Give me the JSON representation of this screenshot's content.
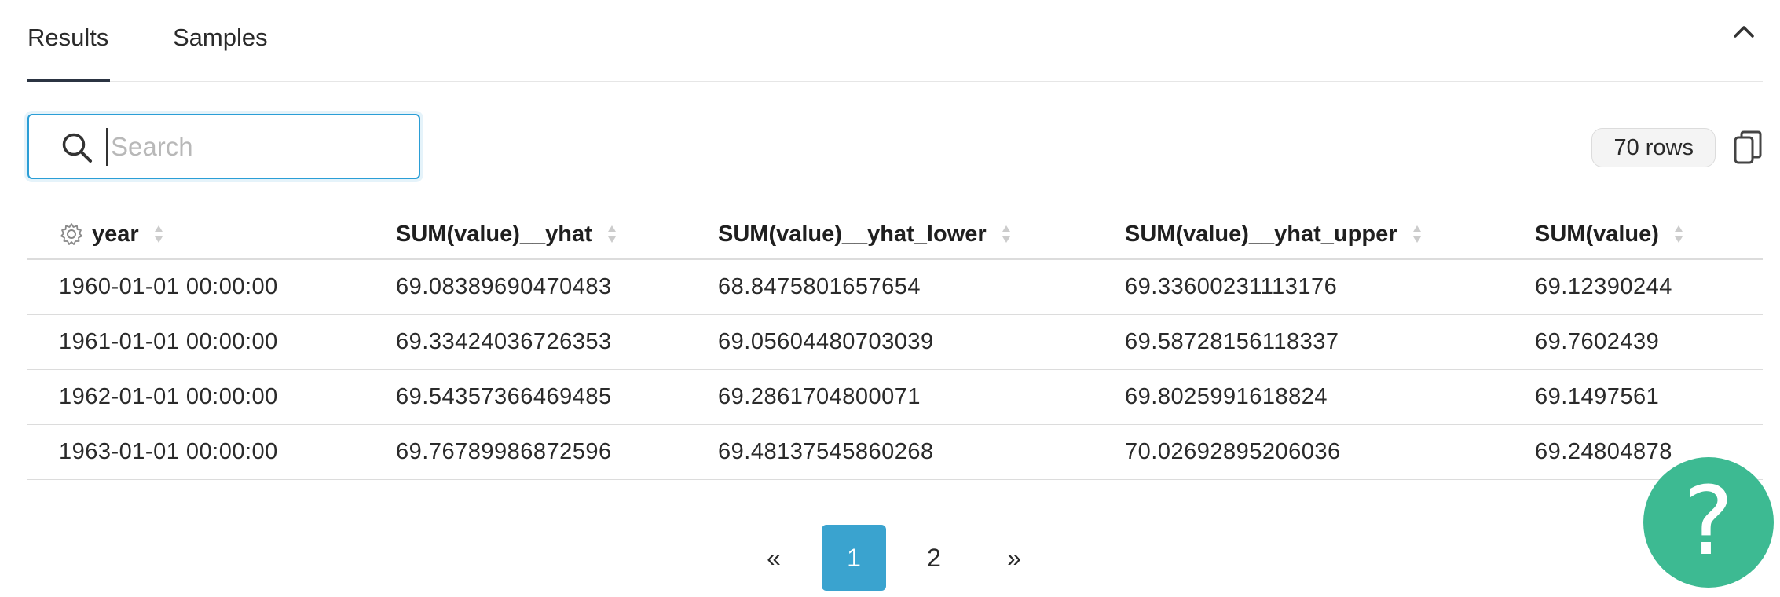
{
  "tabs": [
    {
      "label": "Results",
      "active": true
    },
    {
      "label": "Samples",
      "active": false
    }
  ],
  "search": {
    "placeholder": "Search",
    "value": ""
  },
  "row_count": "70 rows",
  "table": {
    "columns": [
      "year",
      "SUM(value)__yhat",
      "SUM(value)__yhat_lower",
      "SUM(value)__yhat_upper",
      "SUM(value)"
    ],
    "rows": [
      [
        "1960-01-01 00:00:00",
        "69.08389690470483",
        "68.8475801657654",
        "69.33600231113176",
        "69.12390244"
      ],
      [
        "1961-01-01 00:00:00",
        "69.33424036726353",
        "69.05604480703039",
        "69.58728156118337",
        "69.7602439"
      ],
      [
        "1962-01-01 00:00:00",
        "69.54357366469485",
        "69.2861704800071",
        "69.8025991618824",
        "69.1497561"
      ],
      [
        "1963-01-01 00:00:00",
        "69.76789986872596",
        "69.48137545860268",
        "70.02692895206036",
        "69.24804878"
      ]
    ]
  },
  "pagination": {
    "prev": "«",
    "pages": [
      "1",
      "2"
    ],
    "current": "1",
    "next": "»"
  },
  "help": {
    "label": "?"
  },
  "colors": {
    "accent": "#3aa3cf",
    "help": "#3dba92",
    "focus": "#2b9ed6"
  }
}
